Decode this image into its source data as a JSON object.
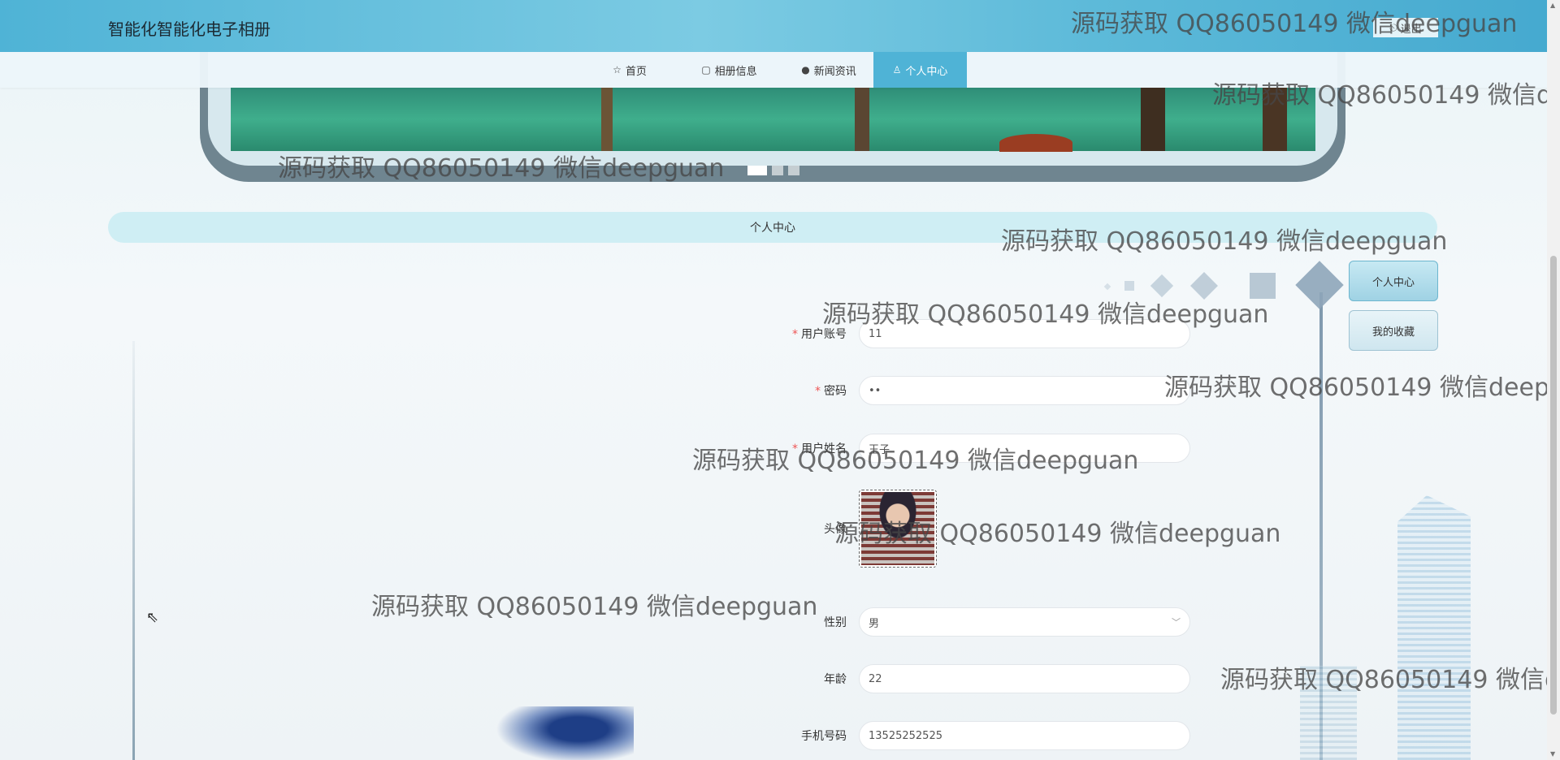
{
  "header": {
    "site_title": "智能化智能化电子相册",
    "logout_label": "退出"
  },
  "nav": {
    "items": [
      {
        "label": "首页",
        "icon": "star-icon"
      },
      {
        "label": "相册信息",
        "icon": "bag-icon"
      },
      {
        "label": "新闻资讯",
        "icon": "info-icon"
      },
      {
        "label": "个人中心",
        "icon": "user-icon",
        "active": true
      }
    ]
  },
  "section": {
    "title": "个人中心"
  },
  "side_menu": {
    "items": [
      {
        "label": "个人中心",
        "active": true
      },
      {
        "label": "我的收藏"
      }
    ]
  },
  "form": {
    "account_label": "用户账号",
    "account_value": "11",
    "password_label": "密码",
    "password_value": "••",
    "name_label": "用户姓名",
    "name_value": "王子",
    "avatar_label": "头像",
    "gender_label": "性别",
    "gender_value": "男",
    "age_label": "年龄",
    "age_value": "22",
    "phone_label": "手机号码",
    "phone_value": "13525252525"
  },
  "watermark": "源码获取 QQ86050149 微信deepguan",
  "colors": {
    "header": "#4fb3d6",
    "nav_active": "#4fb3d6",
    "section_bar": "#cfeef4",
    "required": "#e55555"
  }
}
